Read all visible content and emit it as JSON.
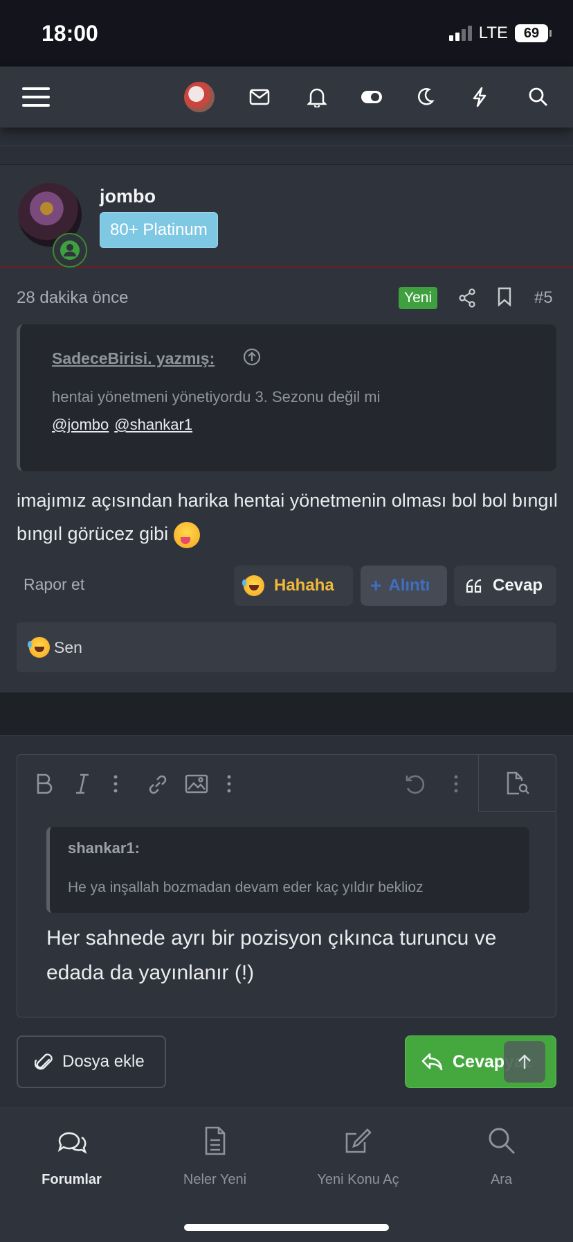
{
  "status": {
    "time": "18:00",
    "network": "LTE",
    "battery": "69"
  },
  "topnav": {
    "icons": [
      "menu-icon",
      "avatar",
      "mail-icon",
      "bell-icon",
      "toggle-icon",
      "moon-icon",
      "bolt-icon",
      "search-icon"
    ]
  },
  "post": {
    "username": "jombo",
    "rank": "80+ Platinum",
    "time": "28 dakika önce",
    "new_badge": "Yeni",
    "number": "#5",
    "quote": {
      "author": "SadeceBirisi. yazmış:",
      "text": "hentai yönetmeni yönetiyordu 3. Sezonu değil mi",
      "mentions": [
        "@jombo",
        "@shankar1"
      ]
    },
    "body": "imajımız açısından harika hentai yönetmenin olması bol bol bıngıl bıngıl görücez gibi",
    "report": "Rapor et",
    "actions": {
      "hahaha": "Hahaha",
      "alinti": "Alıntı",
      "cevap": "Cevap"
    },
    "reactions_by": "Sen"
  },
  "editor": {
    "quote_author": "shankar1:",
    "quote_text": "He ya inşallah bozmadan devam eder kaç yıldır beklioz",
    "text": "Her sahnede ayrı bir pozisyon çıkınca turuncu ve edada da yayınlanır (!)"
  },
  "buttons": {
    "attach": "Dosya ekle",
    "reply": "Cevap",
    "reply_ghost": "yaz"
  },
  "bottomnav": {
    "items": [
      {
        "label": "Forumlar",
        "active": true
      },
      {
        "label": "Neler Yeni",
        "active": false
      },
      {
        "label": "Yeni Konu Aç",
        "active": false
      },
      {
        "label": "Ara",
        "active": false
      }
    ]
  },
  "colors": {
    "accent_green": "#45a83f",
    "rank_blue": "#7ec8e3",
    "bg": "#2b2f37"
  }
}
